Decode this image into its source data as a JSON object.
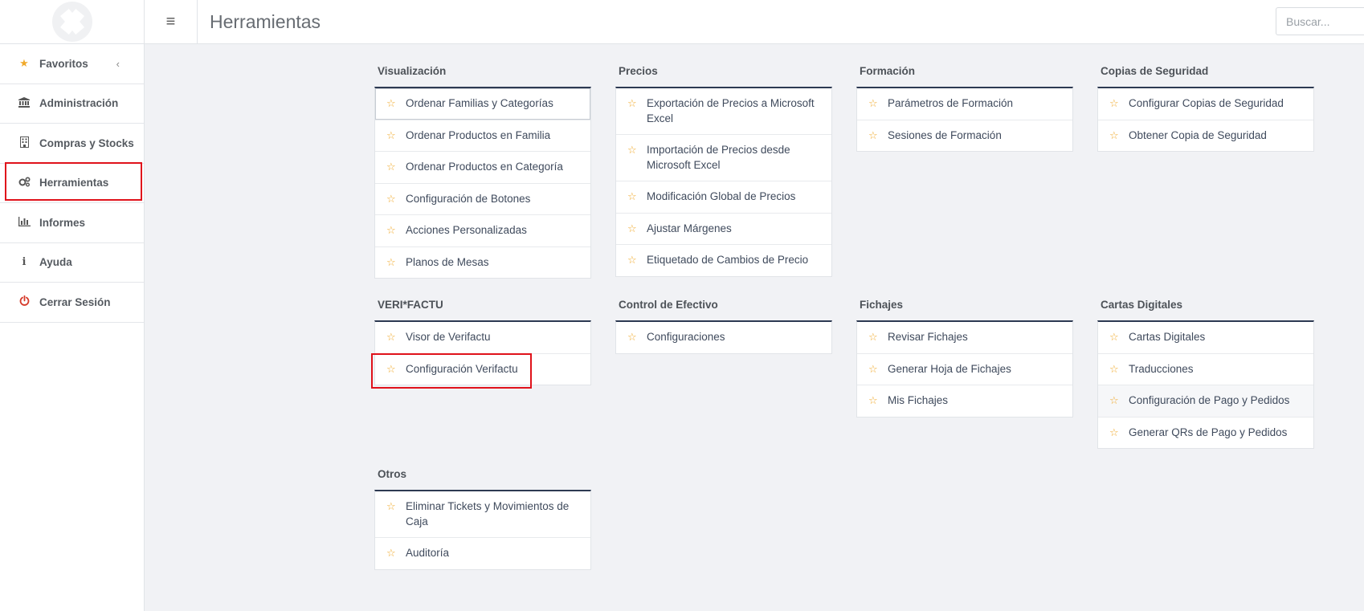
{
  "header": {
    "title": "Herramientas",
    "search_placeholder": "Buscar..."
  },
  "sidebar": {
    "items": [
      {
        "label": "Favoritos",
        "icon": "star-icon",
        "has_chevron": true
      },
      {
        "label": "Administración",
        "icon": "bank-icon"
      },
      {
        "label": "Compras y Stocks",
        "icon": "building-icon"
      },
      {
        "label": "Herramientas",
        "icon": "gears-icon",
        "selected": true
      },
      {
        "label": "Informes",
        "icon": "bar-chart-icon"
      },
      {
        "label": "Ayuda",
        "icon": "info-icon"
      },
      {
        "label": "Cerrar Sesión",
        "icon": "power-icon"
      }
    ]
  },
  "sections": [
    {
      "title": "Visualización",
      "items": [
        "Ordenar Familias y Categorías",
        "Ordenar Productos en Familia",
        "Ordenar Productos en Categoría",
        "Configuración de Botones",
        "Acciones Personalizadas",
        "Planos de Mesas"
      ]
    },
    {
      "title": "Precios",
      "items": [
        "Exportación de Precios a Microsoft Excel",
        "Importación de Precios desde Microsoft Excel",
        "Modificación Global de Precios",
        "Ajustar Márgenes",
        "Etiquetado de Cambios de Precio"
      ]
    },
    {
      "title": "Formación",
      "items": [
        "Parámetros de Formación",
        "Sesiones de Formación"
      ]
    },
    {
      "title": "Copias de Seguridad",
      "items": [
        "Configurar Copias de Seguridad",
        "Obtener Copia de Seguridad"
      ]
    },
    {
      "title": "VERI*FACTU",
      "items": [
        "Visor de Verifactu",
        "Configuración Verifactu"
      ]
    },
    {
      "title": "Control de Efectivo",
      "items": [
        "Configuraciones"
      ]
    },
    {
      "title": "Fichajes",
      "items": [
        "Revisar Fichajes",
        "Generar Hoja de Fichajes",
        "Mis Fichajes"
      ]
    },
    {
      "title": "Cartas Digitales",
      "items": [
        "Cartas Digitales",
        "Traducciones",
        "Configuración de Pago y Pedidos",
        "Generar QRs de Pago y Pedidos"
      ]
    },
    {
      "title": "Otros",
      "items": [
        "Eliminar Tickets y Movimientos de Caja",
        "Auditoría"
      ]
    }
  ],
  "colors": {
    "accent_star": "#f0a92b",
    "card_top_border": "#2d3a52",
    "highlight": "#e0121b"
  }
}
